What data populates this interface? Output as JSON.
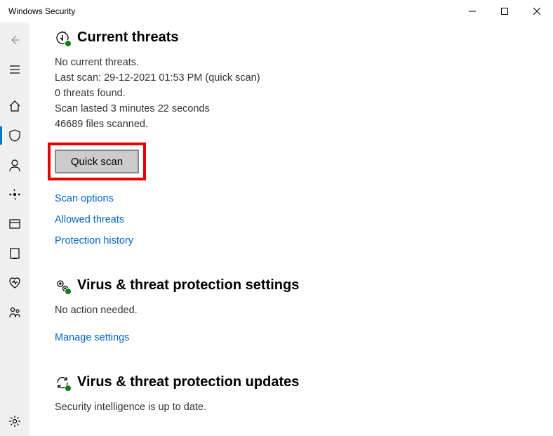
{
  "titlebar": {
    "title": "Windows Security"
  },
  "sections": {
    "threats": {
      "title": "Current threats",
      "status": "No current threats.",
      "lastScan": "Last scan: 29-12-2021 01:53 PM (quick scan)",
      "threatsFound": "0 threats found.",
      "duration": "Scan lasted 3 minutes 22 seconds",
      "filesScanned": "46689 files scanned.",
      "quickScanLabel": "Quick scan",
      "links": {
        "scanOptions": "Scan options",
        "allowedThreats": "Allowed threats",
        "protectionHistory": "Protection history"
      }
    },
    "settings": {
      "title": "Virus & threat protection settings",
      "status": "No action needed.",
      "links": {
        "manage": "Manage settings"
      }
    },
    "updates": {
      "title": "Virus & threat protection updates",
      "status": "Security intelligence is up to date."
    }
  }
}
